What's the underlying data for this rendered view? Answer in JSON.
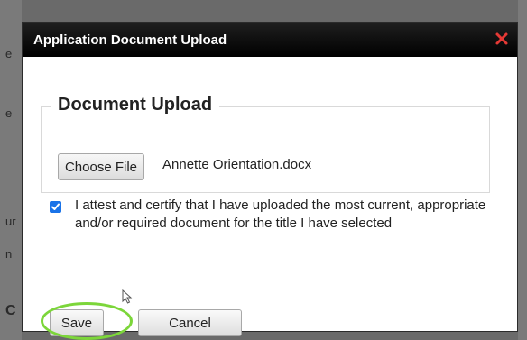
{
  "dialog": {
    "title": "Application Document Upload",
    "close_icon": "close-icon",
    "accent_color": "#e53935"
  },
  "upload": {
    "legend": "Document Upload",
    "choose_file_label": "Choose File",
    "file_name": "Annette Orientation.docx"
  },
  "attestation": {
    "checked": true,
    "text": "I attest and certify that I have uploaded the most current, appropriate and/or required document for the title I have selected"
  },
  "actions": {
    "save_label": "Save",
    "cancel_label": "Cancel",
    "highlight_color": "#7cd63a"
  },
  "background": {
    "fragments": [
      "e",
      "e",
      "ur",
      "n",
      "C"
    ]
  }
}
